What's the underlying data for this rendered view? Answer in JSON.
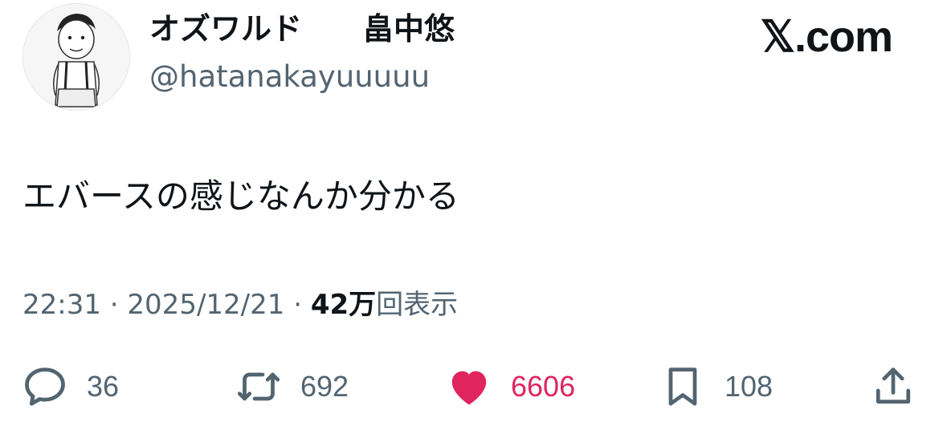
{
  "header": {
    "display_name": "オズワルド　　畠中悠",
    "handle": "@hatanakayuuuuu",
    "brand": "𝕏.com"
  },
  "tweet": {
    "text": "エバースの感じなんか分かる"
  },
  "meta": {
    "time": "22:31",
    "separator": " · ",
    "date": "2025/12/21",
    "views_count": "42万",
    "views_label": "回表示"
  },
  "actions": {
    "reply": {
      "icon": "reply-icon",
      "count": "36"
    },
    "retweet": {
      "icon": "retweet-icon",
      "count": "692"
    },
    "like": {
      "icon": "heart-icon",
      "count": "6606",
      "color": "#e0245e",
      "liked": true
    },
    "bookmark": {
      "icon": "bookmark-icon",
      "count": "108"
    },
    "share": {
      "icon": "share-icon"
    }
  },
  "colors": {
    "text_primary": "#0f1419",
    "text_secondary": "#536471",
    "like_accent": "#e0245e"
  }
}
